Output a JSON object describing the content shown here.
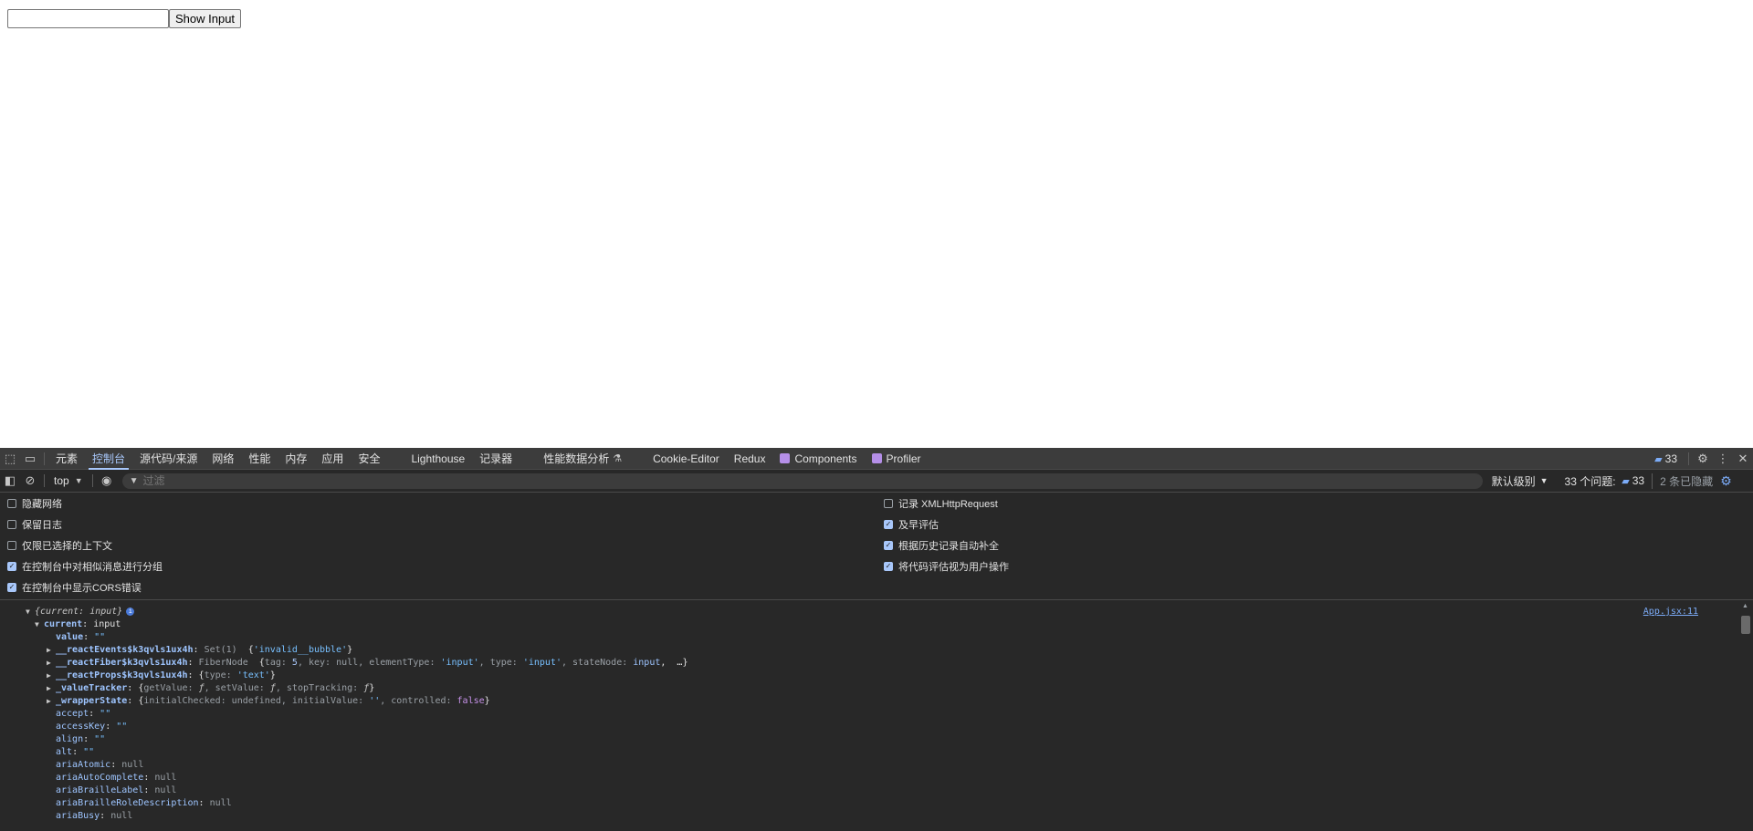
{
  "page": {
    "input_value": "",
    "button_label": "Show Input"
  },
  "devtools": {
    "tabs": [
      {
        "label": "元素"
      },
      {
        "label": "控制台",
        "active": true
      },
      {
        "label": "源代码/来源"
      },
      {
        "label": "网络"
      },
      {
        "label": "性能"
      },
      {
        "label": "内存"
      },
      {
        "label": "应用"
      },
      {
        "label": "安全"
      },
      {
        "label": "Lighthouse"
      },
      {
        "label": "记录器"
      },
      {
        "label": "性能数据分析"
      },
      {
        "label": "Cookie-Editor"
      },
      {
        "label": "Redux"
      },
      {
        "label": "Components"
      },
      {
        "label": "Profiler"
      }
    ],
    "issues_badge": "33",
    "toolbar": {
      "context": "top",
      "filter_placeholder": "过滤",
      "level": "默认级别",
      "issues_label": "33 个问题:",
      "issues_count": "33",
      "hidden": "2 条已隐藏"
    },
    "settings_left": [
      {
        "label": "隐藏网络",
        "checked": false
      },
      {
        "label": "保留日志",
        "checked": false
      },
      {
        "label": "仅限已选择的上下文",
        "checked": false
      },
      {
        "label": "在控制台中对相似消息进行分组",
        "checked": true
      },
      {
        "label": "在控制台中显示CORS错误",
        "checked": true
      }
    ],
    "settings_right": [
      {
        "label": "记录 XMLHttpRequest",
        "checked": false
      },
      {
        "label": "及早评估",
        "checked": true
      },
      {
        "label": "根据历史记录自动补全",
        "checked": true
      },
      {
        "label": "将代码评估视为用户操作",
        "checked": true
      }
    ],
    "console": {
      "source_link": "App.jsx:11",
      "root": "{current: input}",
      "current_key": "current",
      "current_val": "input",
      "value_key": "value",
      "value_val": "\"\"",
      "events_key": "__reactEvents$k3qvls1ux4h",
      "events_type": "Set(1)",
      "events_val": "'invalid__bubble'",
      "fiber_key": "__reactFiber$k3qvls1ux4h",
      "fiber_type": "FiberNode",
      "fiber_tag": "5",
      "fiber_elemtype": "'input'",
      "fiber_typeval": "'input'",
      "fiber_statenode": "input",
      "props_key": "__reactProps$k3qvls1ux4h",
      "props_type": "'text'",
      "tracker_key": "_valueTracker",
      "wrapper_key": "_wrapperState",
      "wrapper_initval": "''",
      "wrapper_controlled": "false",
      "null_val": "null",
      "empty_val": "\"\"",
      "props": [
        {
          "key": "accept",
          "val": "\"\"",
          "str": true
        },
        {
          "key": "accessKey",
          "val": "\"\"",
          "str": true
        },
        {
          "key": "align",
          "val": "\"\"",
          "str": true
        },
        {
          "key": "alt",
          "val": "\"\"",
          "str": true
        },
        {
          "key": "ariaAtomic",
          "val": "null",
          "str": false
        },
        {
          "key": "ariaAutoComplete",
          "val": "null",
          "str": false
        },
        {
          "key": "ariaBrailleLabel",
          "val": "null",
          "str": false
        },
        {
          "key": "ariaBrailleRoleDescription",
          "val": "null",
          "str": false
        },
        {
          "key": "ariaBusy",
          "val": "null",
          "str": false
        }
      ]
    }
  }
}
